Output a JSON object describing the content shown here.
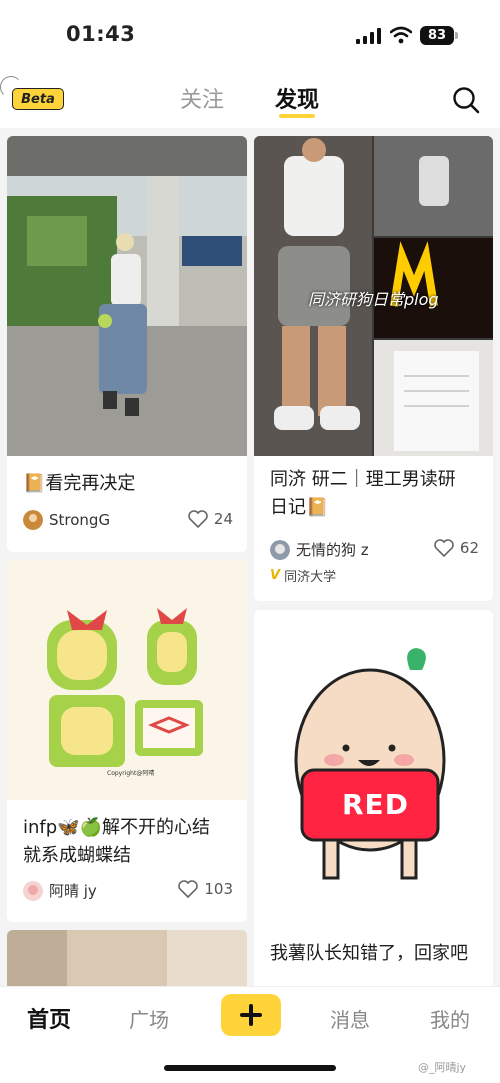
{
  "status": {
    "time": "01:43",
    "battery": "83"
  },
  "header": {
    "beta": "Beta",
    "tabs": [
      "关注",
      "发现"
    ],
    "active_tab": "发现"
  },
  "feed": {
    "cards": [
      {
        "title": "看完再决定",
        "author": "StrongG",
        "likes": "24"
      },
      {
        "title_line1": "同济 研二｜理工男读研",
        "title_line2": "日记",
        "author": "无情的狗 z",
        "likes": "62",
        "school": "同济大学",
        "overlay_text": "同济研狗日常plog"
      },
      {
        "title_line1": "infp",
        "title_line1_b": "解不开的心结",
        "title_line2": "就系成蝴蝶结",
        "author": "阿晴 jy",
        "likes": "103",
        "sticker_caption": "Copyright@阿晴"
      },
      {
        "title": "我薯队长知错了，回家吧",
        "mascot_text": "RED"
      }
    ]
  },
  "bottom_nav": {
    "home": "首页",
    "plaza": "广场",
    "messages": "消息",
    "me": "我的",
    "watermark": "@_阿晴jy"
  },
  "colors": {
    "accent": "#ffd43a",
    "red": "#ff2442"
  }
}
